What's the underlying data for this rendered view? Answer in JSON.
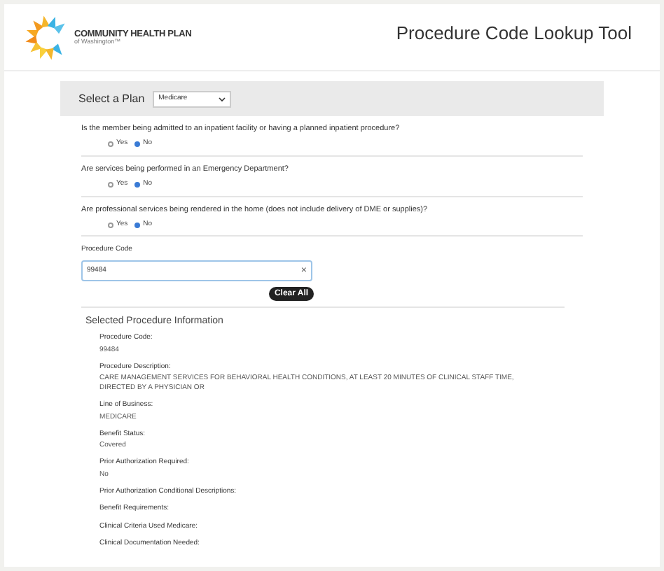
{
  "header": {
    "logo_name": "COMMUNITY HEALTH PLAN",
    "logo_sub": "of Washington™",
    "title": "Procedure Code Lookup Tool"
  },
  "plan": {
    "label": "Select a Plan",
    "value": "Medicare"
  },
  "questions": [
    {
      "text": "Is the member being admitted to an inpatient facility or having a planned inpatient procedure?",
      "options": [
        {
          "label": "Yes",
          "selected": false
        },
        {
          "label": "No",
          "selected": true
        }
      ]
    },
    {
      "text": "Are services being performed in an Emergency Department?",
      "options": [
        {
          "label": "Yes",
          "selected": false
        },
        {
          "label": "No",
          "selected": true
        }
      ]
    },
    {
      "text": "Are professional services being rendered in the home (does not include delivery of DME or supplies)?",
      "options": [
        {
          "label": "Yes",
          "selected": false
        },
        {
          "label": "No",
          "selected": true
        }
      ]
    }
  ],
  "procedure_code": {
    "label": "Procedure Code",
    "value": "99484",
    "clear": "×"
  },
  "clear_all": "Clear All",
  "info": {
    "title": "Selected Procedure Information",
    "fields": [
      {
        "label": "Procedure Code:",
        "value": "99484"
      },
      {
        "label": "Procedure Description:",
        "value": "CARE MANAGEMENT SERVICES FOR BEHAVIORAL HEALTH CONDITIONS, AT LEAST 20 MINUTES OF CLINICAL STAFF TIME, DIRECTED BY A PHYSICIAN OR"
      },
      {
        "label": "Line of Business:",
        "value": "MEDICARE"
      },
      {
        "label": "Benefit Status:",
        "value": "Covered"
      },
      {
        "label": "Prior Authorization Required:",
        "value": "No"
      },
      {
        "label": "Prior Authorization Conditional Descriptions:"
      },
      {
        "label": "Benefit Requirements:"
      },
      {
        "label": "Clinical Criteria Used Medicare:"
      },
      {
        "label": "Clinical Documentation Needed:"
      }
    ]
  }
}
